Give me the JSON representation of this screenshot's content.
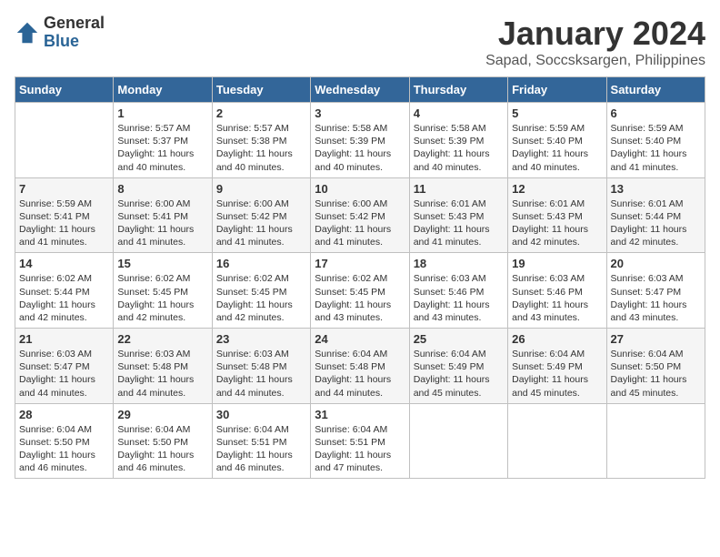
{
  "header": {
    "logo_general": "General",
    "logo_blue": "Blue",
    "month_title": "January 2024",
    "location": "Sapad, Soccsksargen, Philippines"
  },
  "weekdays": [
    "Sunday",
    "Monday",
    "Tuesday",
    "Wednesday",
    "Thursday",
    "Friday",
    "Saturday"
  ],
  "weeks": [
    [
      {
        "day": "",
        "info": ""
      },
      {
        "day": "1",
        "info": "Sunrise: 5:57 AM\nSunset: 5:37 PM\nDaylight: 11 hours\nand 40 minutes."
      },
      {
        "day": "2",
        "info": "Sunrise: 5:57 AM\nSunset: 5:38 PM\nDaylight: 11 hours\nand 40 minutes."
      },
      {
        "day": "3",
        "info": "Sunrise: 5:58 AM\nSunset: 5:39 PM\nDaylight: 11 hours\nand 40 minutes."
      },
      {
        "day": "4",
        "info": "Sunrise: 5:58 AM\nSunset: 5:39 PM\nDaylight: 11 hours\nand 40 minutes."
      },
      {
        "day": "5",
        "info": "Sunrise: 5:59 AM\nSunset: 5:40 PM\nDaylight: 11 hours\nand 40 minutes."
      },
      {
        "day": "6",
        "info": "Sunrise: 5:59 AM\nSunset: 5:40 PM\nDaylight: 11 hours\nand 41 minutes."
      }
    ],
    [
      {
        "day": "7",
        "info": "Sunrise: 5:59 AM\nSunset: 5:41 PM\nDaylight: 11 hours\nand 41 minutes."
      },
      {
        "day": "8",
        "info": "Sunrise: 6:00 AM\nSunset: 5:41 PM\nDaylight: 11 hours\nand 41 minutes."
      },
      {
        "day": "9",
        "info": "Sunrise: 6:00 AM\nSunset: 5:42 PM\nDaylight: 11 hours\nand 41 minutes."
      },
      {
        "day": "10",
        "info": "Sunrise: 6:00 AM\nSunset: 5:42 PM\nDaylight: 11 hours\nand 41 minutes."
      },
      {
        "day": "11",
        "info": "Sunrise: 6:01 AM\nSunset: 5:43 PM\nDaylight: 11 hours\nand 41 minutes."
      },
      {
        "day": "12",
        "info": "Sunrise: 6:01 AM\nSunset: 5:43 PM\nDaylight: 11 hours\nand 42 minutes."
      },
      {
        "day": "13",
        "info": "Sunrise: 6:01 AM\nSunset: 5:44 PM\nDaylight: 11 hours\nand 42 minutes."
      }
    ],
    [
      {
        "day": "14",
        "info": "Sunrise: 6:02 AM\nSunset: 5:44 PM\nDaylight: 11 hours\nand 42 minutes."
      },
      {
        "day": "15",
        "info": "Sunrise: 6:02 AM\nSunset: 5:45 PM\nDaylight: 11 hours\nand 42 minutes."
      },
      {
        "day": "16",
        "info": "Sunrise: 6:02 AM\nSunset: 5:45 PM\nDaylight: 11 hours\nand 42 minutes."
      },
      {
        "day": "17",
        "info": "Sunrise: 6:02 AM\nSunset: 5:45 PM\nDaylight: 11 hours\nand 43 minutes."
      },
      {
        "day": "18",
        "info": "Sunrise: 6:03 AM\nSunset: 5:46 PM\nDaylight: 11 hours\nand 43 minutes."
      },
      {
        "day": "19",
        "info": "Sunrise: 6:03 AM\nSunset: 5:46 PM\nDaylight: 11 hours\nand 43 minutes."
      },
      {
        "day": "20",
        "info": "Sunrise: 6:03 AM\nSunset: 5:47 PM\nDaylight: 11 hours\nand 43 minutes."
      }
    ],
    [
      {
        "day": "21",
        "info": "Sunrise: 6:03 AM\nSunset: 5:47 PM\nDaylight: 11 hours\nand 44 minutes."
      },
      {
        "day": "22",
        "info": "Sunrise: 6:03 AM\nSunset: 5:48 PM\nDaylight: 11 hours\nand 44 minutes."
      },
      {
        "day": "23",
        "info": "Sunrise: 6:03 AM\nSunset: 5:48 PM\nDaylight: 11 hours\nand 44 minutes."
      },
      {
        "day": "24",
        "info": "Sunrise: 6:04 AM\nSunset: 5:48 PM\nDaylight: 11 hours\nand 44 minutes."
      },
      {
        "day": "25",
        "info": "Sunrise: 6:04 AM\nSunset: 5:49 PM\nDaylight: 11 hours\nand 45 minutes."
      },
      {
        "day": "26",
        "info": "Sunrise: 6:04 AM\nSunset: 5:49 PM\nDaylight: 11 hours\nand 45 minutes."
      },
      {
        "day": "27",
        "info": "Sunrise: 6:04 AM\nSunset: 5:50 PM\nDaylight: 11 hours\nand 45 minutes."
      }
    ],
    [
      {
        "day": "28",
        "info": "Sunrise: 6:04 AM\nSunset: 5:50 PM\nDaylight: 11 hours\nand 46 minutes."
      },
      {
        "day": "29",
        "info": "Sunrise: 6:04 AM\nSunset: 5:50 PM\nDaylight: 11 hours\nand 46 minutes."
      },
      {
        "day": "30",
        "info": "Sunrise: 6:04 AM\nSunset: 5:51 PM\nDaylight: 11 hours\nand 46 minutes."
      },
      {
        "day": "31",
        "info": "Sunrise: 6:04 AM\nSunset: 5:51 PM\nDaylight: 11 hours\nand 47 minutes."
      },
      {
        "day": "",
        "info": ""
      },
      {
        "day": "",
        "info": ""
      },
      {
        "day": "",
        "info": ""
      }
    ]
  ]
}
